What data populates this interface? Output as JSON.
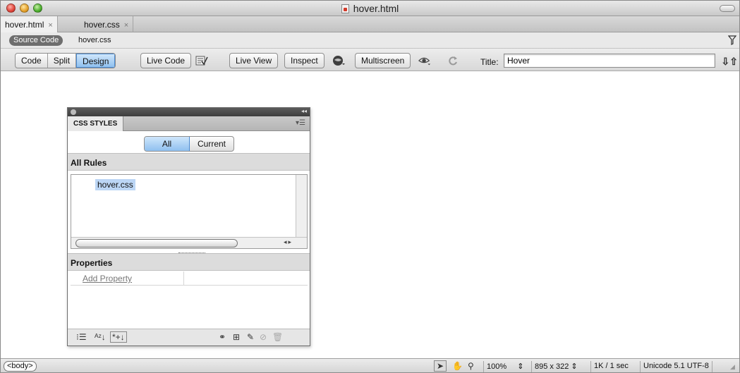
{
  "window": {
    "title": "hover.html"
  },
  "doc_tabs": [
    {
      "label": "hover.html",
      "close": "×",
      "active": true
    },
    {
      "label": "hover.css",
      "close": "×",
      "active": false
    }
  ],
  "related_files": {
    "source_code": "Source Code",
    "file": "hover.css"
  },
  "toolbar": {
    "view_buttons": [
      "Code",
      "Split",
      "Design"
    ],
    "active_view": "Design",
    "live_code": "Live Code",
    "live_view": "Live View",
    "inspect": "Inspect",
    "multiscreen": "Multiscreen",
    "title_label": "Title:",
    "title_value": "Hover"
  },
  "css_panel": {
    "tab": "CSS STYLES",
    "toggle": [
      "All",
      "Current"
    ],
    "active_toggle": "All",
    "all_rules_heading": "All Rules",
    "rules": [
      "hover.css"
    ],
    "properties_heading": "Properties",
    "add_property": "Add Property"
  },
  "status_bar": {
    "tag": "<body>",
    "zoom": "100%",
    "window_size": "895 x 322",
    "download": "1K / 1 sec",
    "encoding": "Unicode 5.1 UTF-8"
  }
}
